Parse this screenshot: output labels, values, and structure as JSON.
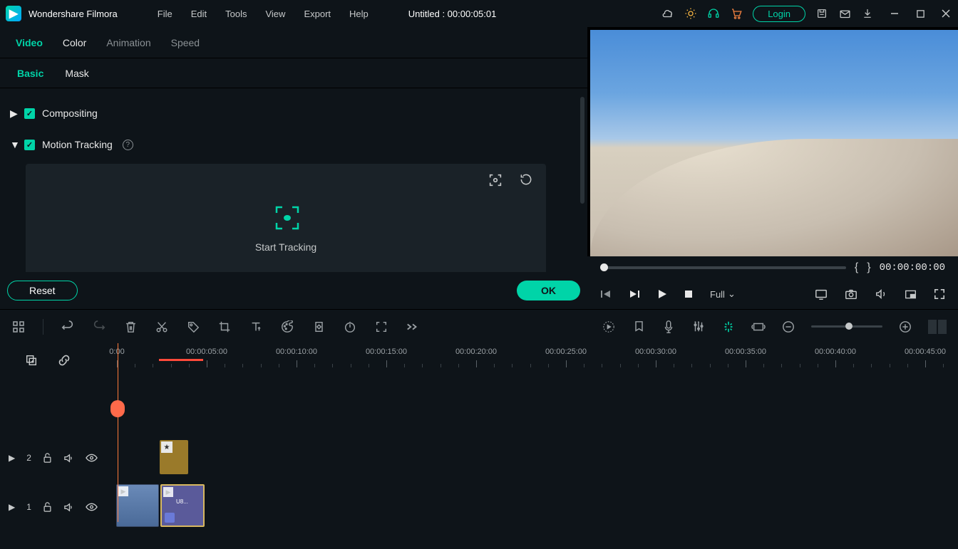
{
  "app_name": "Wondershare Filmora",
  "menus": [
    "File",
    "Edit",
    "Tools",
    "View",
    "Export",
    "Help"
  ],
  "project_title": "Untitled : 00:00:05:01",
  "login_label": "Login",
  "prop_tabs": [
    "Video",
    "Color",
    "Animation",
    "Speed"
  ],
  "sub_tabs": [
    "Basic",
    "Mask"
  ],
  "sect_compositing": "Compositing",
  "sect_motion": "Motion Tracking",
  "start_tracking": "Start Tracking",
  "reset_label": "Reset",
  "ok_label": "OK",
  "preview_tc": "00:00:00:00",
  "quality_label": "Full",
  "ruler": [
    "0:00",
    "00:00:05:00",
    "00:00:10:00",
    "00:00:15:00",
    "00:00:20:00",
    "00:00:25:00",
    "00:00:30:00",
    "00:00:35:00",
    "00:00:40:00",
    "00:00:45:00"
  ],
  "track2_num": "2",
  "track1_num": "1",
  "clip_label": "U8..."
}
